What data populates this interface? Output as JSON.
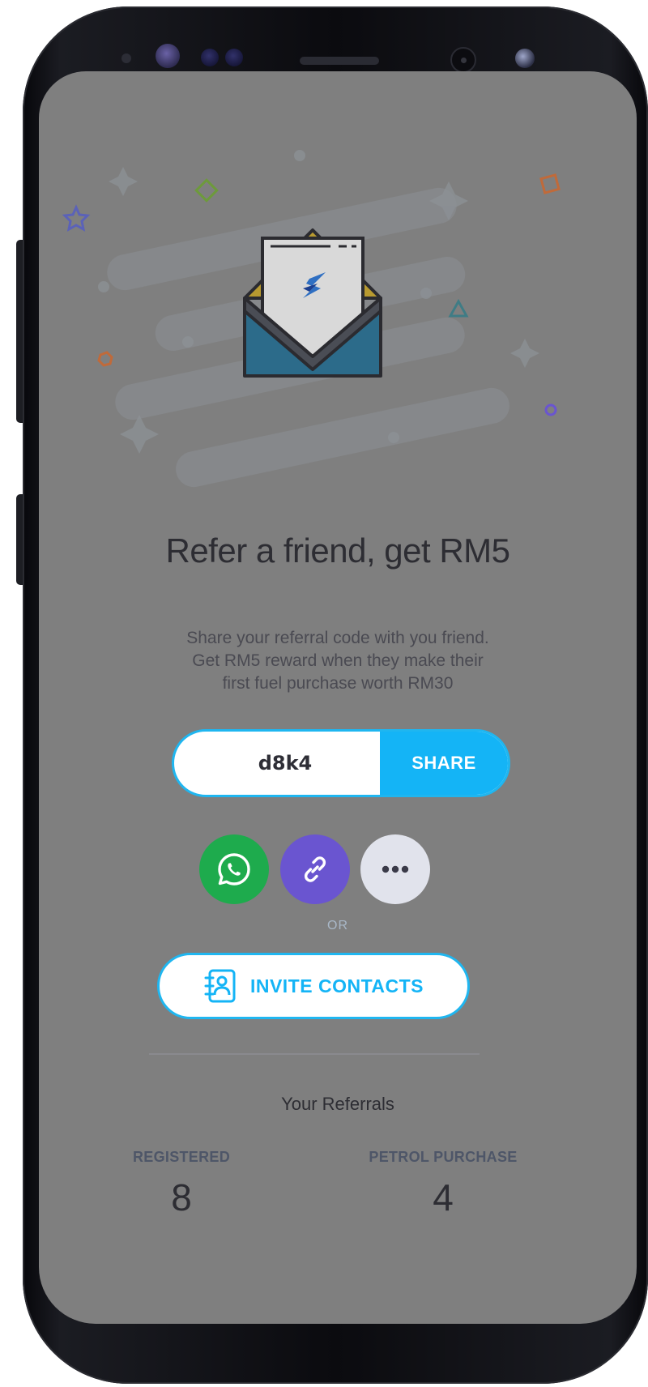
{
  "referral": {
    "headline": "Refer a friend, get RM5",
    "description_lines": [
      "Share your referral code with you friend.",
      "Get RM5 reward when they make their",
      "first fuel purchase worth RM30"
    ],
    "code": "d8k4",
    "share_label": "SHARE",
    "share_options": [
      {
        "name": "WhatsApp",
        "icon": "whatsapp-icon",
        "color": "#1eab4d"
      },
      {
        "name": "Copy link",
        "icon": "link-icon",
        "color": "#6a55d0"
      },
      {
        "name": "More",
        "icon": "more-dots-icon",
        "color": "#e1e3ec"
      }
    ],
    "or_label": "OR",
    "invite_label": "INVITE CONTACTS",
    "invite_icon": "contacts-book-icon"
  },
  "your_referrals": {
    "title": "Your Referrals",
    "registered_label": "REGISTERED",
    "registered_count": "8",
    "petrol_purchase_label": "PETROL PURCHASE",
    "petrol_purchase_count": "4"
  },
  "colors": {
    "accent": "#14b4f6",
    "overlay_background": "#7f7f7f",
    "whatsapp": "#1eab4d",
    "link": "#6a55d0"
  }
}
